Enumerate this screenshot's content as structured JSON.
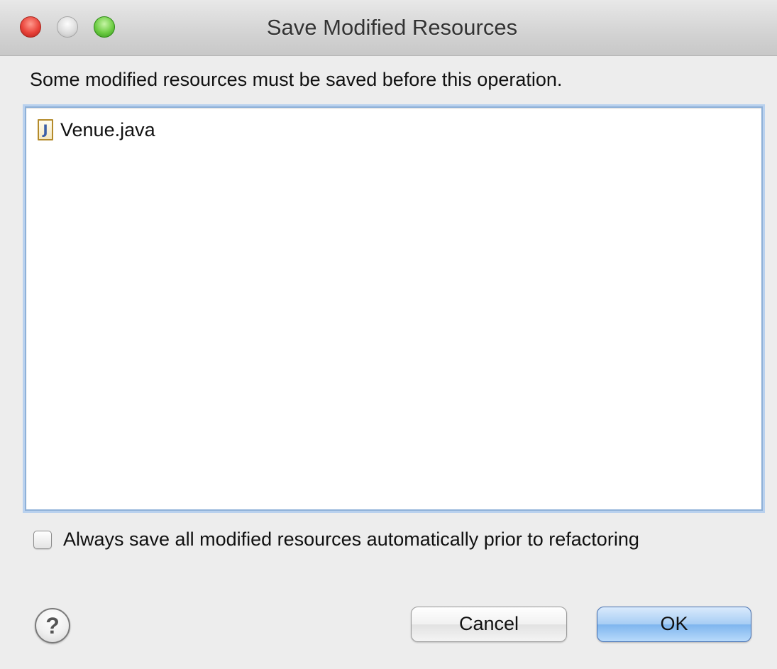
{
  "window": {
    "title": "Save Modified Resources"
  },
  "dialog": {
    "message": "Some modified resources must be saved before this operation.",
    "resources": [
      {
        "icon": "java-file-icon",
        "icon_glyph": "J",
        "name": "Venue.java"
      }
    ],
    "always_save": {
      "label": "Always save all modified resources automatically prior to refactoring",
      "checked": false
    },
    "help_glyph": "?",
    "buttons": {
      "cancel": "Cancel",
      "ok": "OK"
    }
  },
  "colors": {
    "close": "#e9433a",
    "minimize": "#dadada",
    "zoom": "#6dcc43",
    "default_button": "#7eb5ee",
    "focus_ring": "#b9d1ee"
  }
}
